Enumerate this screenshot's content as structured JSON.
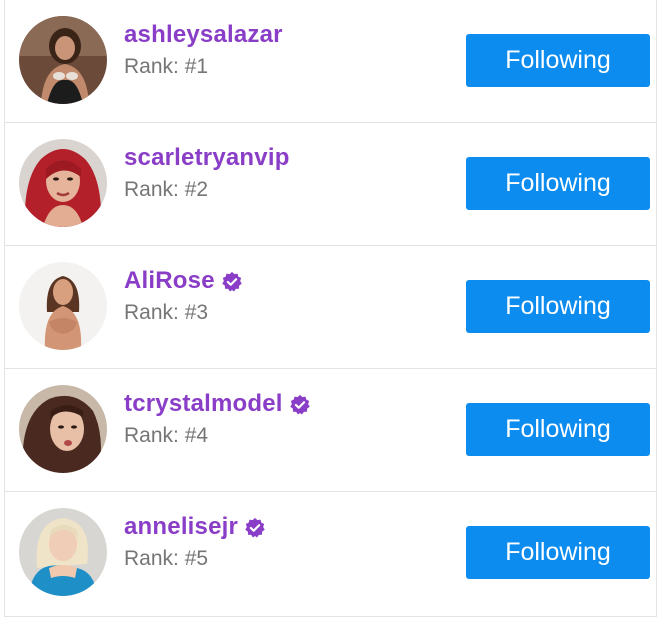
{
  "colors": {
    "accent_purple": "#8a3ec7",
    "button_blue": "#0d8cf0",
    "rank_gray": "#757575",
    "divider": "#e3e3e3"
  },
  "users": [
    {
      "username": "ashleysalazar",
      "rank": "Rank: #1",
      "verified": false,
      "button_label": "Following",
      "avatar_icon": "user-avatar"
    },
    {
      "username": "scarletryanvip",
      "rank": "Rank: #2",
      "verified": false,
      "button_label": "Following",
      "avatar_icon": "user-avatar"
    },
    {
      "username": "AliRose",
      "rank": "Rank: #3",
      "verified": true,
      "button_label": "Following",
      "avatar_icon": "user-avatar"
    },
    {
      "username": "tcrystalmodel",
      "rank": "Rank: #4",
      "verified": true,
      "button_label": "Following",
      "avatar_icon": "user-avatar"
    },
    {
      "username": "annelisejr",
      "rank": "Rank: #5",
      "verified": true,
      "button_label": "Following",
      "avatar_icon": "user-avatar"
    }
  ]
}
